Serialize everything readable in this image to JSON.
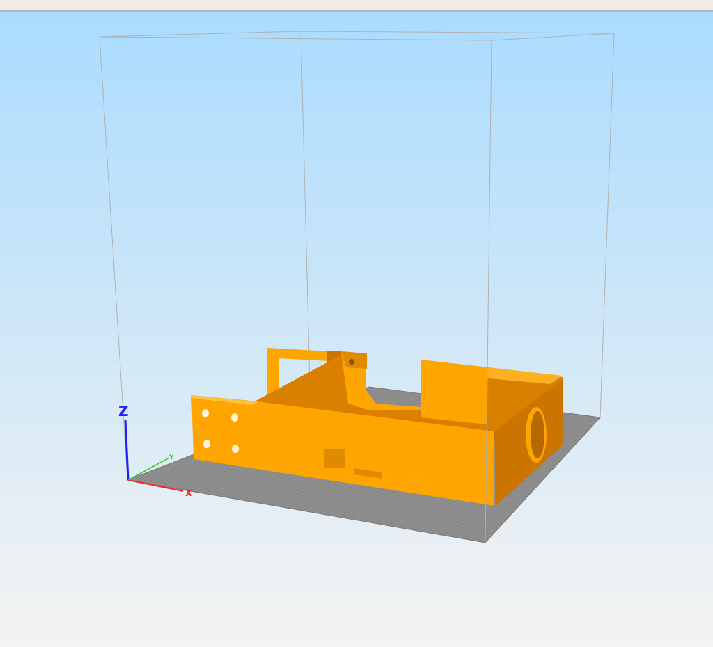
{
  "viewport": {
    "axes": {
      "x_label": "X",
      "y_label": "Y",
      "z_label": "Z"
    },
    "colors": {
      "model": "#ffa500",
      "model_shade": "#cc7400",
      "plate": "#8c8c8c",
      "x_axis": "#ff2020",
      "y_axis": "#20d020",
      "z_axis": "#2020ff"
    }
  }
}
